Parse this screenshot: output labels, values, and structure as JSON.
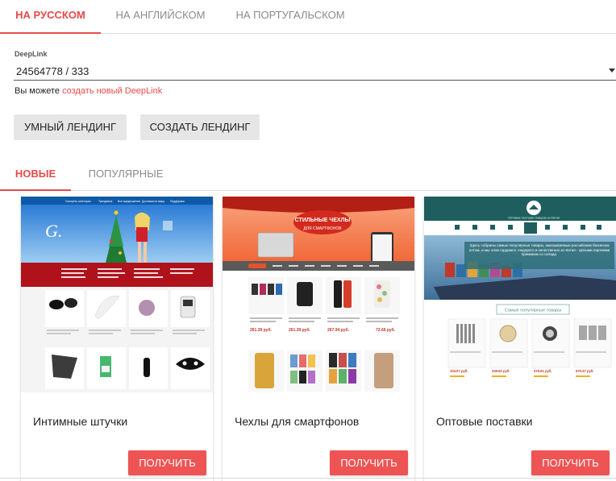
{
  "lang_tabs": [
    {
      "label": "На русском",
      "active": true
    },
    {
      "label": "На английском",
      "active": false
    },
    {
      "label": "На португальском",
      "active": false
    }
  ],
  "deeplink": {
    "label": "DeepLink",
    "value": "24564778 / 333",
    "hint_prefix": "Вы можете",
    "hint_link": "создать новый DeepLink"
  },
  "buttons": {
    "smart_landing": "Умный лендинг",
    "create_landing": "Создать лендинг"
  },
  "sub_tabs": [
    {
      "label": "Новые",
      "active": true
    },
    {
      "label": "Популярные",
      "active": false
    }
  ],
  "cards": [
    {
      "title": "Интимные штучки",
      "button": "Получить",
      "preview": {
        "nav": [
          "Смотреть категории",
          "Трендовые",
          "Все предложения",
          "Доставка по миру",
          "Поддержка"
        ]
      }
    },
    {
      "title": "Чехлы для смартфонов",
      "button": "Получить",
      "preview": {
        "banner_line1": "СТИЛЬНЫЕ ЧЕХЛЫ",
        "banner_line2": "ДЛЯ СМАРТФОНОВ",
        "prices": [
          "261.39 руб.",
          "261.39 руб.",
          "267.94 руб.",
          "72.66 руб."
        ]
      }
    },
    {
      "title": "Оптовые поставки",
      "button": "Получить",
      "preview": {
        "header": "Оптовые поставки товаров из Китая",
        "hero_text": "Здесь собраны самые популярные товары, заказываемые российским бизнесом оптом, и мы этим гордимся. Недорого и качественно из Китая - целыми партиями прямиком со склада.",
        "section": "Самые популярные товары",
        "prices": [
          "104.07 руб.",
          "249.81 руб.",
          "476.61 руб.",
          "570.47 руб."
        ]
      }
    }
  ],
  "colors": {
    "accent": "#e84a4a",
    "button": "#ee5454",
    "grey_button": "#e6e6e6",
    "teal_header": "#1f5e5e"
  }
}
